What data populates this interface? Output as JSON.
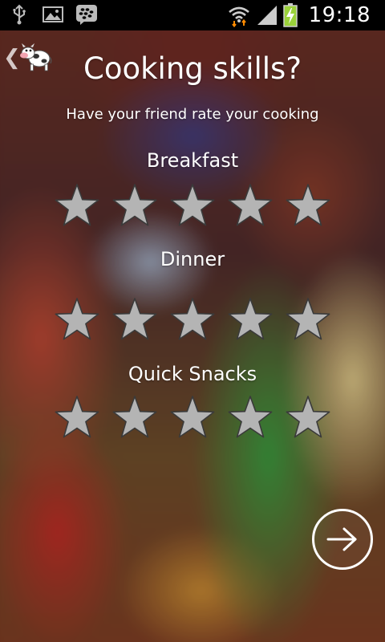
{
  "status_bar": {
    "time": "19:18",
    "left_icons": [
      "usb-icon",
      "image-icon",
      "blackberry-messenger-icon"
    ],
    "right_icons": [
      "wifi-icon",
      "signal-icon",
      "battery-charging-icon"
    ]
  },
  "header": {
    "back_icon": "chevron-left-icon",
    "logo_icon": "cow-logo-icon"
  },
  "main": {
    "title": "Cooking skills?",
    "subtitle": "Have your friend rate your cooking",
    "categories": [
      {
        "label": "Breakfast",
        "rating": 0,
        "max": 5
      },
      {
        "label": "Dinner",
        "rating": 0,
        "max": 5
      },
      {
        "label": "Quick Snacks",
        "rating": 0,
        "max": 5
      }
    ]
  },
  "next_button": {
    "icon": "arrow-right-icon"
  },
  "colors": {
    "star_fill": "#b4b4b4",
    "star_stroke": "#3a3a3a",
    "text": "#ffffff"
  }
}
